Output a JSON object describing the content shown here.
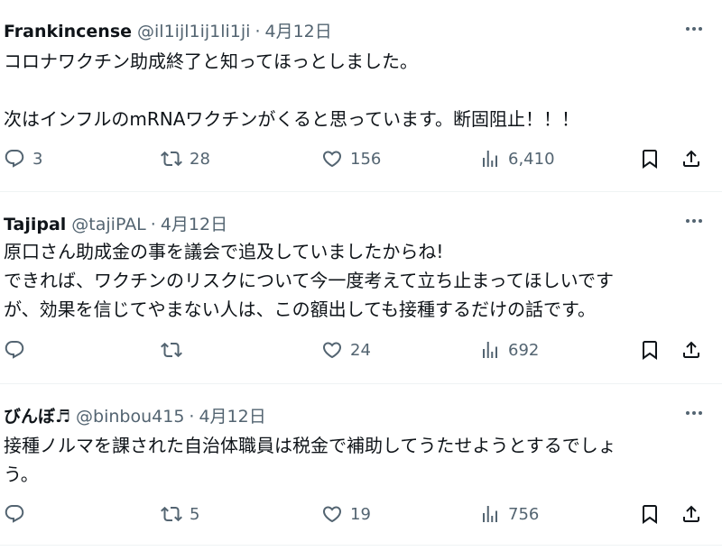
{
  "tweets": [
    {
      "name": "Frankincense",
      "handle": "@il1ijl1ij1li1ji",
      "separator": "·",
      "date": "4月12日",
      "lines": [
        "コロナワクチン助成終了と知ってほっとしました。",
        "",
        "次はインフルのmRNAワクチンがくると思っています。断固阻止！！！"
      ],
      "replies": "3",
      "retweets": "28",
      "likes": "156",
      "views": "6,410"
    },
    {
      "name": "Tajipal",
      "handle": "@tajiPAL",
      "separator": "·",
      "date": "4月12日",
      "lines": [
        "原口さん助成金の事を議会で追及していましたからね!",
        "できれば、ワクチンのリスクについて今一度考えて立ち止まってほしいです",
        "が、効果を信じてやまない人は、この額出しても接種するだけの話です。"
      ],
      "replies": "",
      "retweets": "",
      "likes": "24",
      "views": "692"
    },
    {
      "name": "びんぼ♬",
      "handle": "@binbou415",
      "separator": "·",
      "date": "4月12日",
      "lines": [
        "接種ノルマを課された自治体職員は税金で補助してうたせようとするでしょ",
        "う。"
      ],
      "replies": "",
      "retweets": "5",
      "likes": "19",
      "views": "756"
    }
  ],
  "icons": {
    "more": "more-dots-icon",
    "reply": "reply-bubble-icon",
    "retweet": "retweet-icon",
    "like": "heart-icon",
    "views": "views-bar-chart-icon",
    "bookmark": "bookmark-icon",
    "share": "share-upload-icon"
  },
  "colors": {
    "text": "#0f1419",
    "secondary": "#536471",
    "divider": "#eff3f4"
  }
}
